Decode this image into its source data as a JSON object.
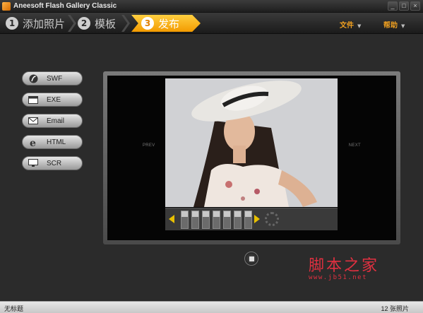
{
  "window": {
    "title": "Aneesoft Flash Gallery Classic",
    "controls": [
      "_",
      "□",
      "×"
    ]
  },
  "steps": [
    {
      "num": "1",
      "label": "添加照片",
      "active": false
    },
    {
      "num": "2",
      "label": "模板",
      "active": false
    },
    {
      "num": "3",
      "label": "发布",
      "active": true
    }
  ],
  "menu": {
    "file": "文件",
    "help": "帮助"
  },
  "publish_buttons": [
    {
      "label": "SWF",
      "icon": "flash-icon"
    },
    {
      "label": "EXE",
      "icon": "window-icon"
    },
    {
      "label": "Email",
      "icon": "envelope-icon"
    },
    {
      "label": "HTML",
      "icon": "ie-icon"
    },
    {
      "label": "SCR",
      "icon": "monitor-icon"
    }
  ],
  "preview": {
    "prev": "PREV",
    "next": "NEXT",
    "thumb_count": 7
  },
  "watermark": {
    "title": "脚本之家",
    "url": "www.jb51.net"
  },
  "status": {
    "left": "无标题",
    "right": "12 张照片"
  },
  "colors": {
    "accent": "#f39b00",
    "menu": "#f0a020",
    "watermark": "#e03040"
  }
}
